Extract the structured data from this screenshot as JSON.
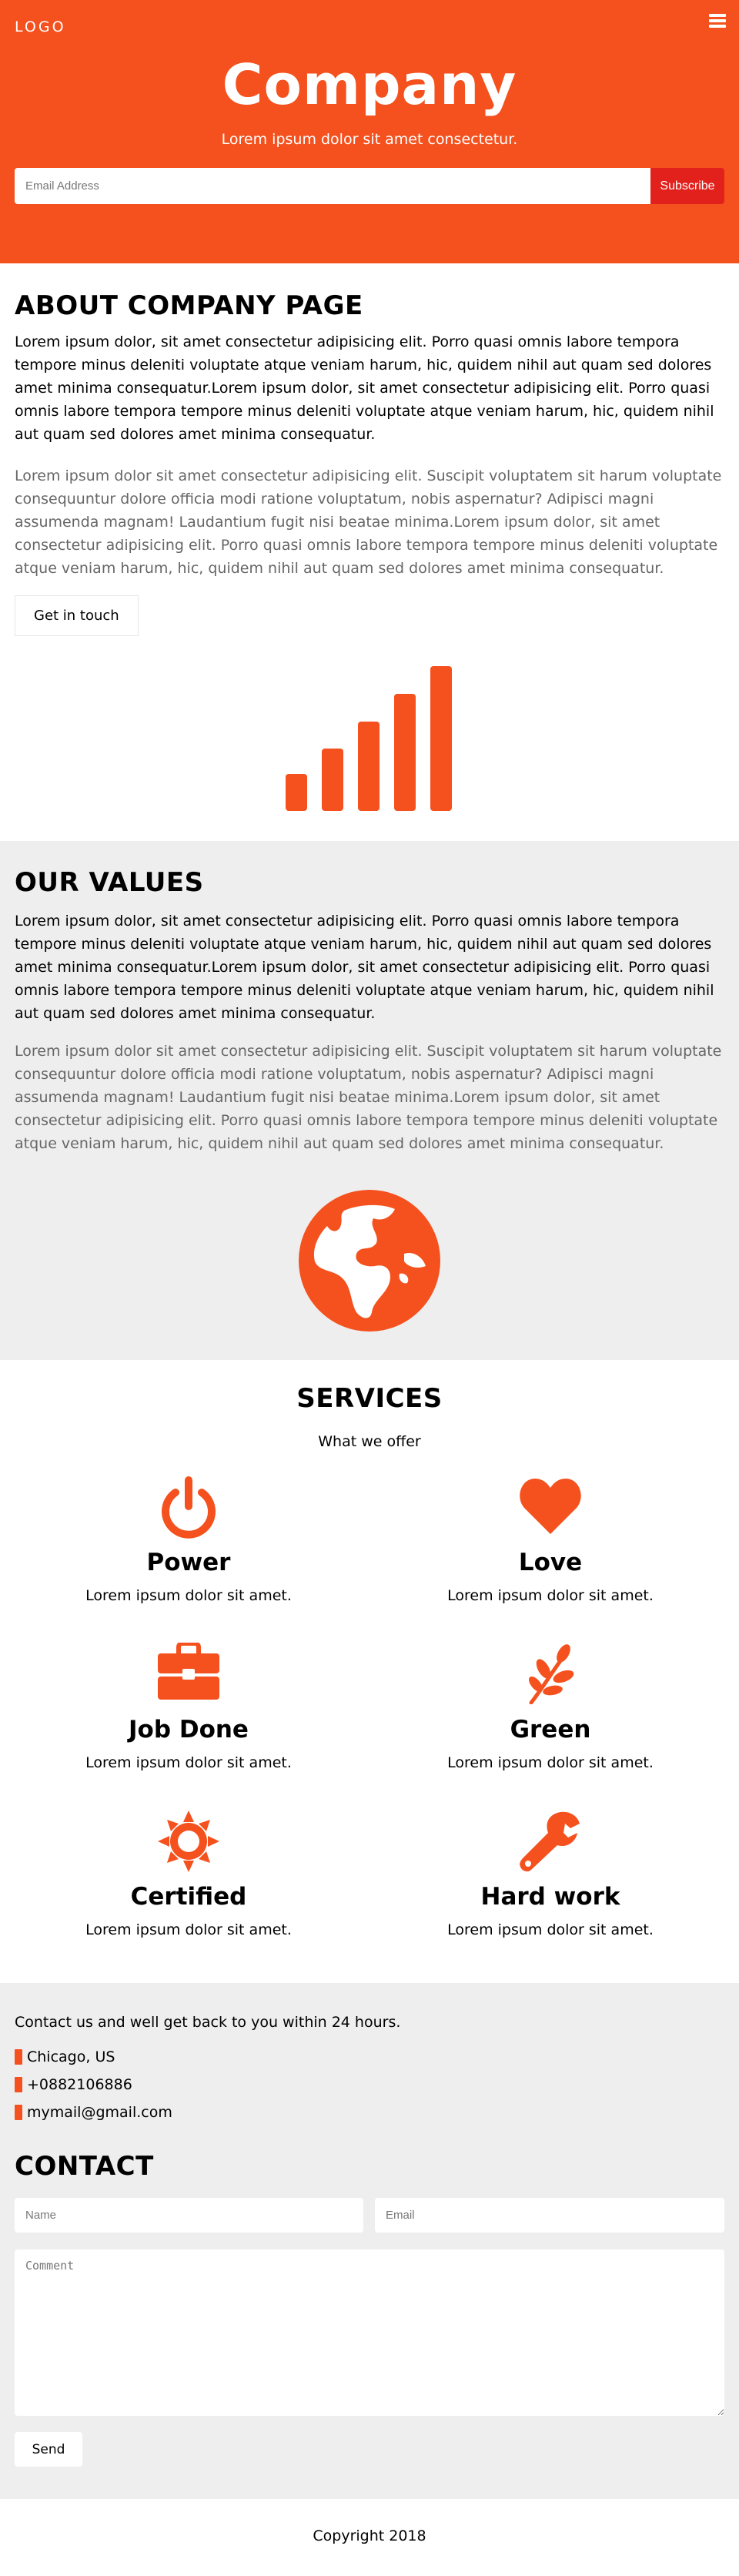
{
  "header": {
    "logo": "LOGO",
    "title": "Company",
    "subtitle": "Lorem ipsum dolor sit amet consectetur.",
    "email_placeholder": "Email Address",
    "subscribe_label": "Subscribe"
  },
  "about": {
    "heading": "ABOUT COMPANY PAGE",
    "paragraph_dark": "Lorem ipsum dolor, sit amet consectetur adipisicing elit. Porro quasi omnis labore tempora tempore minus deleniti voluptate atque veniam harum, hic, quidem nihil aut quam sed dolores amet minima consequatur.Lorem ipsum dolor, sit amet consectetur adipisicing elit. Porro quasi omnis labore tempora tempore minus deleniti voluptate atque veniam harum, hic, quidem nihil aut quam sed dolores amet minima consequatur.",
    "paragraph_grey": "Lorem ipsum dolor sit amet consectetur adipisicing elit. Suscipit voluptatem sit harum voluptate consequuntur dolore officia modi ratione voluptatum, nobis aspernatur? Adipisci magni assumenda magnam! Laudantium fugit nisi beatae minima.Lorem ipsum dolor, sit amet consectetur adipisicing elit. Porro quasi omnis labore tempora tempore minus deleniti voluptate atque veniam harum, hic, quidem nihil aut quam sed dolores amet minima consequatur.",
    "button_label": "Get in touch",
    "icon": "signal-bars-icon"
  },
  "values": {
    "heading": "OUR VALUES",
    "paragraph_dark": "Lorem ipsum dolor, sit amet consectetur adipisicing elit. Porro quasi omnis labore tempora tempore minus deleniti voluptate atque veniam harum, hic, quidem nihil aut quam sed dolores amet minima consequatur.Lorem ipsum dolor, sit amet consectetur adipisicing elit. Porro quasi omnis labore tempora tempore minus deleniti voluptate atque veniam harum, hic, quidem nihil aut quam sed dolores amet minima consequatur.",
    "paragraph_grey": "Lorem ipsum dolor sit amet consectetur adipisicing elit. Suscipit voluptatem sit harum voluptate consequuntur dolore officia modi ratione voluptatum, nobis aspernatur? Adipisci magni assumenda magnam! Laudantium fugit nisi beatae minima.Lorem ipsum dolor, sit amet consectetur adipisicing elit. Porro quasi omnis labore tempora tempore minus deleniti voluptate atque veniam harum, hic, quidem nihil aut quam sed dolores amet minima consequatur.",
    "icon": "globe-icon"
  },
  "services": {
    "heading": "SERVICES",
    "subtitle": "What we offer",
    "items": [
      {
        "name": "Power",
        "desc": "Lorem ipsum dolor sit amet.",
        "icon": "power-icon"
      },
      {
        "name": "Love",
        "desc": "Lorem ipsum dolor sit amet.",
        "icon": "heart-icon"
      },
      {
        "name": "Job Done",
        "desc": "Lorem ipsum dolor sit amet.",
        "icon": "briefcase-icon"
      },
      {
        "name": "Green",
        "desc": "Lorem ipsum dolor sit amet.",
        "icon": "leaf-icon"
      },
      {
        "name": "Certified",
        "desc": "Lorem ipsum dolor sit amet.",
        "icon": "certificate-icon"
      },
      {
        "name": "Hard work",
        "desc": "Lorem ipsum dolor sit amet.",
        "icon": "wrench-icon"
      }
    ]
  },
  "contact": {
    "intro": "Contact us and well get back to you within 24 hours.",
    "location": "Chicago, US",
    "phone": "+0882106886",
    "email": "mymail@gmail.com",
    "heading": "CONTACT",
    "name_placeholder": "Name",
    "email_placeholder": "Email",
    "comment_placeholder": "Comment",
    "send_label": "Send"
  },
  "footer": {
    "copyright": "Copyright 2018"
  },
  "colors": {
    "brand": "#f4511e",
    "subscribe": "#e2211c",
    "section_grey": "#eeeeee"
  }
}
